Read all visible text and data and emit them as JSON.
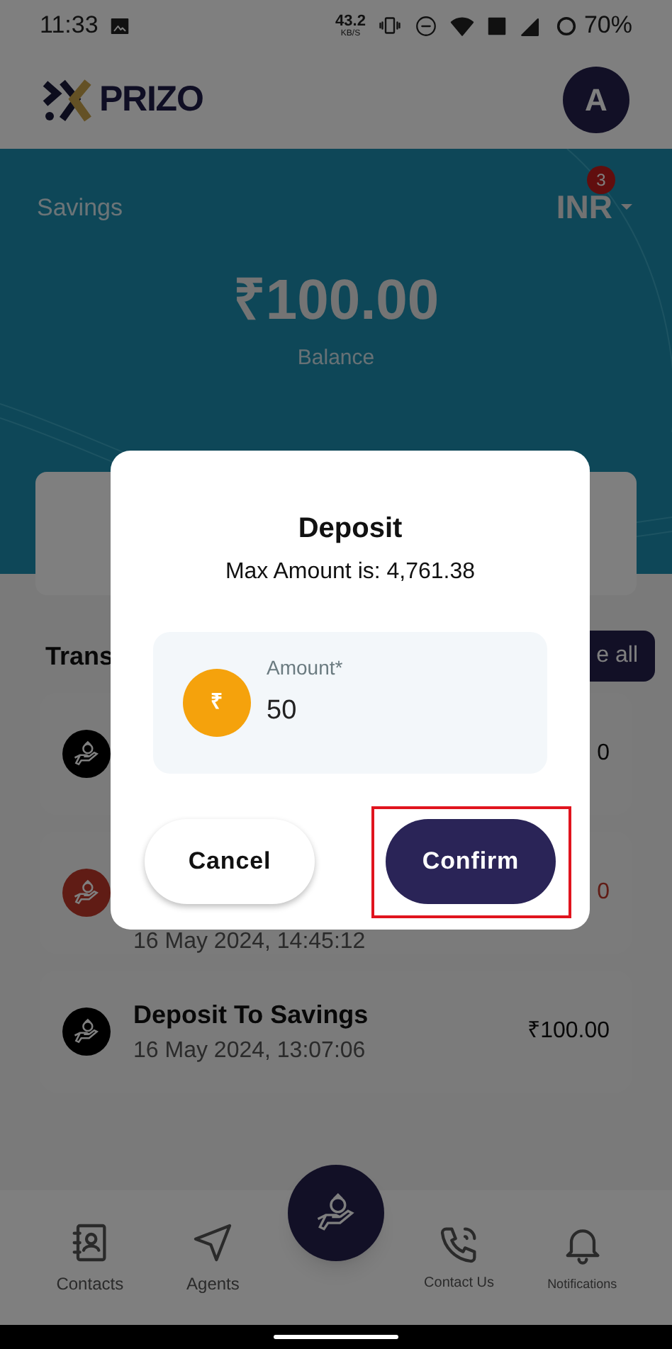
{
  "status_bar": {
    "time": "11:33",
    "speed": "43.2",
    "speed_unit": "KB/S",
    "battery": "70%"
  },
  "header": {
    "brand": "PRIZO",
    "avatar": "A"
  },
  "balance_card": {
    "account": "Savings",
    "currency": "INR",
    "badge": "3",
    "amount": "₹100.00",
    "caption": "Balance"
  },
  "transactions": {
    "heading": "Trans",
    "see_all": "e all",
    "rows": [
      {
        "kind": "deposit",
        "amount": "0"
      },
      {
        "kind": "withdrawal",
        "date": "16 May 2024, 14:45:12",
        "amount": "0"
      },
      {
        "kind": "deposit",
        "title": "Deposit To Savings",
        "date": "16 May 2024, 13:07:06",
        "amount": "₹100.00"
      }
    ]
  },
  "bottom_nav": [
    {
      "kind": "contacts",
      "label": "Contacts"
    },
    {
      "kind": "agents",
      "label": "Agents"
    },
    {
      "kind": "fab"
    },
    {
      "kind": "phone",
      "label": "Contact Us"
    },
    {
      "kind": "bell",
      "label": "Notifications"
    }
  ],
  "dialog": {
    "title": "Deposit",
    "subtitle": "Max Amount is: 4,761.38",
    "field_label": "Amount*",
    "field_value": "50",
    "currency_symbol": "₹",
    "buttons": [
      {
        "kind": "secondary",
        "label": "Cancel",
        "highlighted": false
      },
      {
        "kind": "primary",
        "label": "Confirm",
        "highlighted": true
      }
    ]
  }
}
